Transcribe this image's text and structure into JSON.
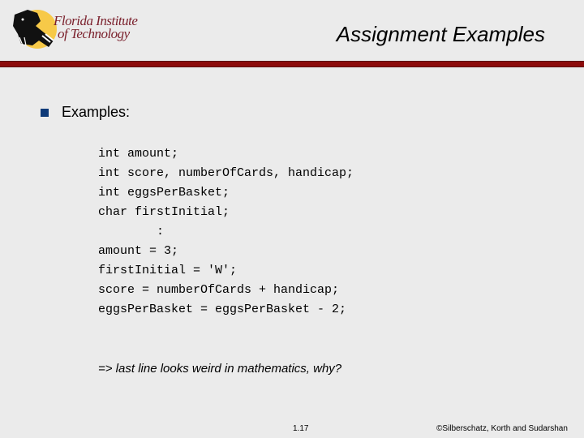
{
  "header": {
    "logo_line1": "Florida Institute",
    "logo_line2": "of Technology",
    "title": "Assignment Examples"
  },
  "colors": {
    "title_bar": "#8c0a0a",
    "bullet": "#0f3a78",
    "logo_text": "#7a1f2b",
    "logo_sun": "#f7c948",
    "background": "#ebebeb"
  },
  "content": {
    "bullet_label": "Examples:",
    "code_lines": [
      "int amount;",
      "int score, numberOfCards, handicap;",
      "int eggsPerBasket;",
      "char firstInitial;",
      "        :",
      "amount = 3;",
      "firstInitial = 'W';",
      "score = numberOfCards + handicap;",
      "eggsPerBasket = eggsPerBasket - 2;"
    ],
    "note": "=> last line looks weird in mathematics, why?"
  },
  "footer": {
    "page_number": "1.17",
    "copyright": "©Silberschatz, Korth and Sudarshan"
  }
}
